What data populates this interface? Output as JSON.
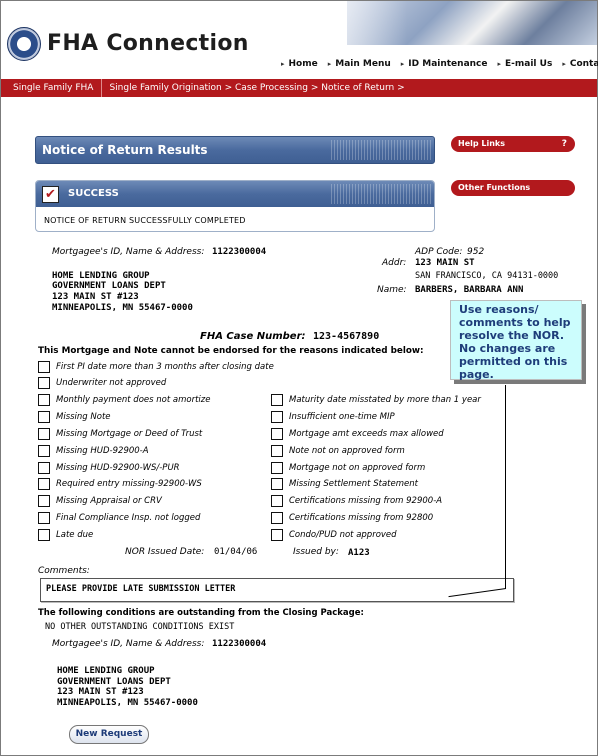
{
  "header": {
    "logo_text": "FHA Connection",
    "nav": [
      {
        "label": "Home"
      },
      {
        "label": "Main Menu"
      },
      {
        "label": "ID Maintenance"
      },
      {
        "label": "E-mail Us"
      },
      {
        "label": "Contact Us"
      }
    ]
  },
  "breadcrumb": {
    "home": "Single Family FHA",
    "path": "Single Family Origination > Case Processing > Notice of Return >"
  },
  "results": {
    "title": "Notice of Return Results",
    "success_label": "SUCCESS",
    "message": "NOTICE OF RETURN SUCCESSFULLY COMPLETED"
  },
  "side": {
    "help_links": "Help Links",
    "help_q": "?",
    "other_functions": "Other Functions"
  },
  "mortgagee": {
    "label": "Mortgagee's ID, Name & Address:",
    "id": "1122300004",
    "lines": [
      "HOME LENDING GROUP",
      "GOVERNMENT LOANS DEPT",
      "123 MAIN ST #123",
      "MINNEAPOLIS, MN 55467-0000"
    ]
  },
  "property": {
    "adp_label": "ADP Code:",
    "adp_value": "952",
    "addr_label": "Addr:",
    "addr_line1": "123 MAIN ST",
    "addr_line2": "SAN FRANCISCO, CA 94131-0000",
    "name_label": "Name:",
    "name_value": "BARBERS, BARBARA ANN"
  },
  "case": {
    "label": "FHA Case Number:",
    "value": "123-4567890"
  },
  "reasons": {
    "heading": "This Mortgage and Note cannot be endorsed for the reasons indicated below:",
    "left": [
      "First PI date more than 3 months after closing date",
      "Underwriter not approved",
      "Monthly payment does not amortize",
      "Missing Note",
      "Missing Mortgage or Deed of Trust",
      "Missing HUD-92900-A",
      "Missing HUD-92900-WS/-PUR",
      "Required entry missing-92900-WS",
      "Missing Appraisal or CRV",
      "Final Compliance Insp. not logged",
      "Late due"
    ],
    "right": [
      "Maturity date misstated by more than 1 year",
      "Insufficient one-time MIP",
      "Mortgage amt exceeds max allowed",
      "Note not on approved form",
      "Mortgage not on approved form",
      "Missing Settlement Statement",
      "Certifications missing from 92900-A",
      "Certifications missing from 92800",
      "Condo/PUD not approved"
    ]
  },
  "issued": {
    "date_label": "NOR Issued Date:",
    "date_value": "01/04/06",
    "by_label": "Issued by:",
    "by_value": "A123"
  },
  "comments": {
    "label": "Comments:",
    "value": "PLEASE PROVIDE LATE SUBMISSION LETTER"
  },
  "callout": {
    "text": "Use reasons/ comments to help resolve the NOR. No changes are permitted on this page."
  },
  "conditions": {
    "heading": "The following conditions are outstanding from the Closing Package:",
    "value": "NO OTHER OUTSTANDING CONDITIONS EXIST"
  },
  "mortgagee2": {
    "label": "Mortgagee's ID, Name & Address:",
    "id": "1122300004",
    "lines": [
      "HOME LENDING GROUP",
      "GOVERNMENT LOANS DEPT",
      "123 MAIN ST #123",
      "MINNEAPOLIS, MN 55467-0000"
    ]
  },
  "actions": {
    "new_request": "New Request"
  }
}
